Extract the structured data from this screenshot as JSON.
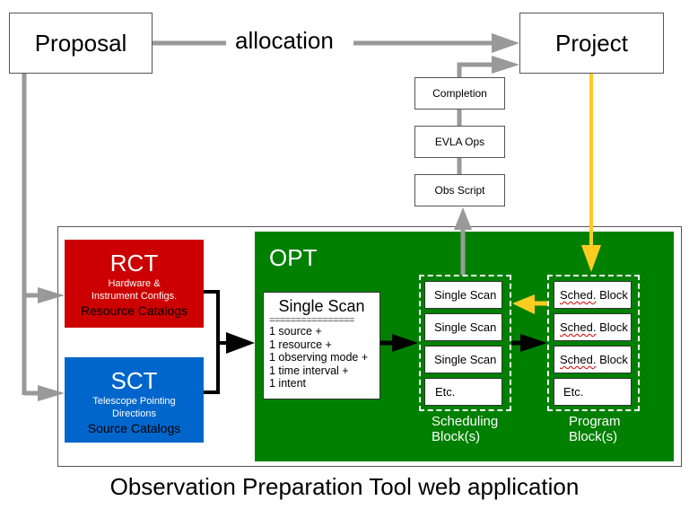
{
  "top": {
    "proposal": "Proposal",
    "allocation": "allocation",
    "project": "Project"
  },
  "pipeline": {
    "completion": "Completion",
    "evla_ops": "EVLA Ops",
    "obs_script": "Obs Script"
  },
  "catalogs": {
    "rct": {
      "title": "RCT",
      "line1": "Hardware &",
      "line2": "Instrument Configs.",
      "subtitle": "Resource Catalogs",
      "color": "#cc0000"
    },
    "sct": {
      "title": "SCT",
      "line1": "Telescope Pointing",
      "line2": "Directions",
      "subtitle": "Source Catalogs",
      "color": "#0066cc"
    }
  },
  "opt": {
    "title": "OPT",
    "color": "#008000",
    "single_scan": {
      "title": "Single Scan",
      "separator": "================",
      "items": [
        "1 source +",
        "1 resource +",
        "1 observing mode +",
        "1 time interval +",
        "1 intent"
      ]
    },
    "scheduling_blocks": {
      "items": [
        "Single Scan",
        "Single Scan",
        "Single Scan",
        "Etc."
      ],
      "label_line1": "Scheduling",
      "label_line2": "Block(s)"
    },
    "program_blocks": {
      "items": [
        {
          "word": "Sched.",
          "rest": " Block"
        },
        {
          "word": "Sched.",
          "rest": " Block"
        },
        {
          "word": "Sched.",
          "rest": " Block"
        }
      ],
      "etc": "Etc.",
      "label_line1": "Program",
      "label_line2": "Block(s)"
    }
  },
  "caption": "Observation Preparation Tool web application",
  "colors": {
    "gray_arrow": "#999999",
    "yellow_arrow": "#ffcc22",
    "black_arrow": "#000000"
  }
}
